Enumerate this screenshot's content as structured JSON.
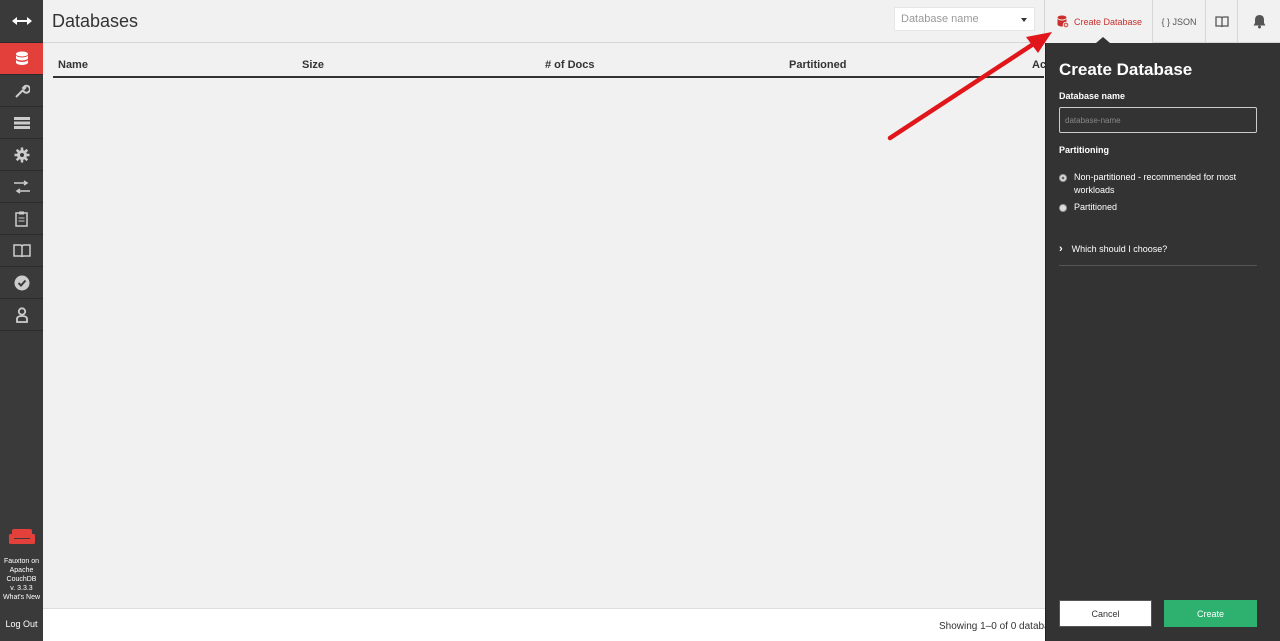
{
  "sidebar": {
    "items": [
      {
        "name": "toggle-icon"
      },
      {
        "name": "databases-icon"
      },
      {
        "name": "wrench-icon"
      },
      {
        "name": "active-tasks-icon"
      },
      {
        "name": "gear-icon"
      },
      {
        "name": "replication-icon"
      },
      {
        "name": "clipboard-icon"
      },
      {
        "name": "book-icon"
      },
      {
        "name": "check-icon"
      },
      {
        "name": "user-icon"
      }
    ],
    "footer": {
      "line1": "Fauxton on",
      "line2": "Apache",
      "line3": "CouchDB",
      "version": "v. 3.3.3",
      "whats_new": "What's New"
    },
    "logout": "Log Out"
  },
  "header": {
    "title": "Databases",
    "search_placeholder": "Database name",
    "create_button": "Create Database",
    "json_button": "{ } JSON"
  },
  "table": {
    "columns": [
      "Name",
      "Size",
      "# of Docs",
      "Partitioned",
      "Ac"
    ]
  },
  "footer": {
    "status": "Showing 1–0 of 0 databas"
  },
  "tray": {
    "title": "Create Database",
    "name_label": "Database name",
    "name_placeholder": "database-name",
    "partition_label": "Partitioning",
    "option_non_partitioned": "Non-partitioned - recommended for most workloads",
    "option_partitioned": "Partitioned",
    "which_link": "Which should I choose?",
    "cancel": "Cancel",
    "create": "Create"
  },
  "colors": {
    "accent_red": "#e33f3b",
    "create_green": "#2eb06f",
    "tray_bg": "#333333",
    "sidebar_bg": "#3a3a3a"
  }
}
